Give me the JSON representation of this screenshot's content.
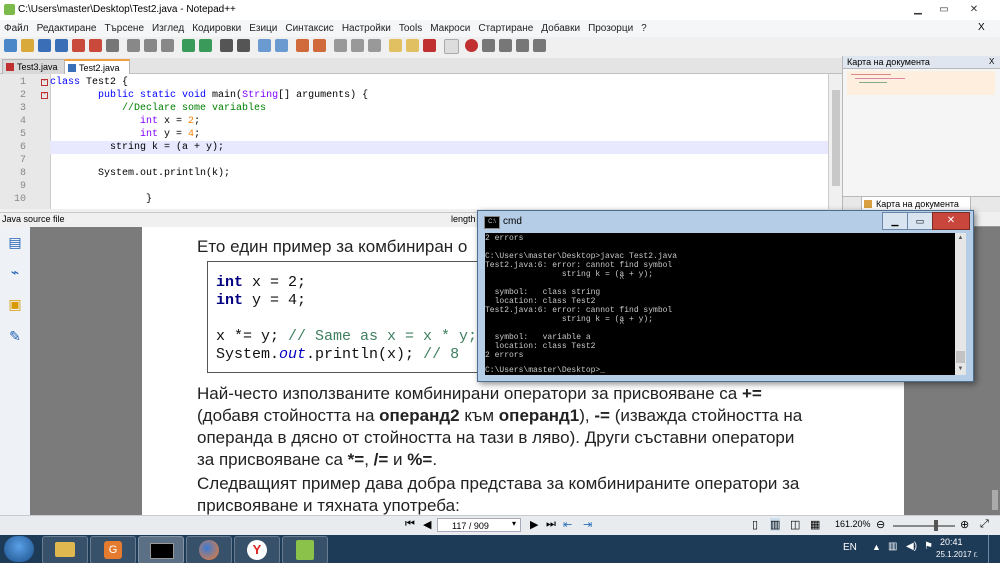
{
  "npp": {
    "title": "C:\\Users\\master\\Desktop\\Test2.java - Notepad++",
    "menu": [
      "Файл",
      "Редактиране",
      "Търсене",
      "Изглед",
      "Кодировки",
      "Езици",
      "Синтаксис",
      "Настройки",
      "Tools",
      "Макроси",
      "Стартиране",
      "Добавки",
      "Прозорци",
      "?"
    ],
    "menu_close": "X",
    "tabs": [
      "Test3.java",
      "Test2.java"
    ],
    "active_tab": 1,
    "lines": [
      {
        "n": "1",
        "t": "class Test2 {"
      },
      {
        "n": "2",
        "t": "    public static void main(String[] arguments) {"
      },
      {
        "n": "3",
        "t": "        //Declare some variables"
      },
      {
        "n": "4",
        "t": "        int x = 2;"
      },
      {
        "n": "5",
        "t": "        int y = 4;"
      },
      {
        "n": "6",
        "t": "     string k = (a + y);"
      },
      {
        "n": "7",
        "t": ""
      },
      {
        "n": "8",
        "t": "    System.out.println(k);"
      },
      {
        "n": "9",
        "t": ""
      },
      {
        "n": "10",
        "t": "        }"
      }
    ],
    "status_left": "Java source file",
    "status_length": "length"
  },
  "docmap": {
    "title": "Карта на документа",
    "tab": "Карта на документа",
    "close": "X"
  },
  "cmd": {
    "title": "cmd",
    "lines": [
      "2 errors",
      "",
      "C:\\Users\\master\\Desktop>javac Test2.java",
      "Test2.java:6: error: cannot find symbol",
      "                string k = (a + y);",
      "                            ^",
      "  symbol:   class string",
      "  location: class Test2",
      "Test2.java:6: error: cannot find symbol",
      "                string k = (a + y);",
      "                            ^",
      "  symbol:   variable a",
      "  location: class Test2",
      "2 errors",
      "",
      "C:\\Users\\master\\Desktop>_"
    ]
  },
  "pdf": {
    "heading": "Ето един пример за комбиниран о",
    "code": {
      "l1_kw": "int",
      "l1_rest": " x = 2;",
      "l2_kw": "int",
      "l2_rest": " y = 4;",
      "l3_code": "x *= y; ",
      "l3_comment": "// Same as x = x * y;",
      "l4_a": "System.",
      "l4_it": "out",
      "l4_b": ".println(x); ",
      "l4_comment": "// 8"
    },
    "para1_a": "Най-често използваните комбинирани оператори за присвояване са ",
    "para1_b": "+=",
    "para1_c": "(добавя стойността на ",
    "para1_d": "операнд2",
    "para1_e": " към ",
    "para1_f": "операнд1",
    "para1_g": "), ",
    "para1_h": "-=",
    "para1_i": " (изважда стойността на",
    "para1_j": "операнда в дясно от стойността на тази в ляво). Други съставни оператори",
    "para1_k": "за присвояване са ",
    "para1_l": "*=",
    "para1_m": ", ",
    "para1_n": "/=",
    "para1_o": " и ",
    "para1_p": "%=",
    "para1_q": ".",
    "para2_1": "Следващият пример дава добра представа за комбинираните оператори за",
    "para2_2": "присвояване и тяхната употреба:",
    "page_value": "117 / 909",
    "zoom": "161.20%"
  },
  "taskbar": {
    "lang": "EN",
    "time": "20:41",
    "date": "25.1.2017 г."
  }
}
